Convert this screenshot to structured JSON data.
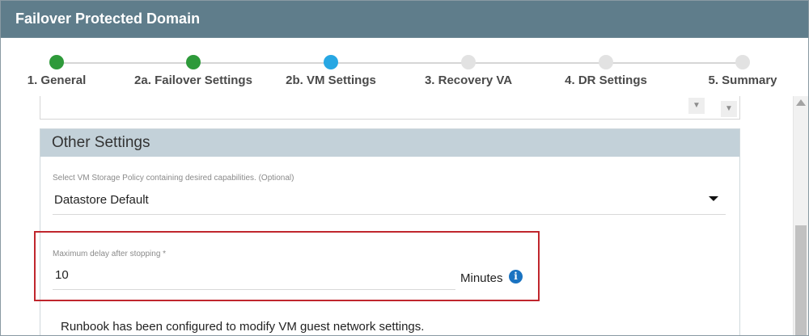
{
  "window": {
    "title": "Failover Protected Domain"
  },
  "stepper": {
    "steps": [
      {
        "label": "1. General",
        "state": "complete",
        "color": "#2e9a3a"
      },
      {
        "label": "2a. Failover Settings",
        "state": "complete",
        "color": "#2e9a3a"
      },
      {
        "label": "2b. VM Settings",
        "state": "active",
        "color": "#27a7e3"
      },
      {
        "label": "3. Recovery VA",
        "state": "pending",
        "color": "#e2e2e2"
      },
      {
        "label": "4. DR Settings",
        "state": "pending",
        "color": "#e2e2e2"
      },
      {
        "label": "5. Summary",
        "state": "pending",
        "color": "#e2e2e2"
      }
    ]
  },
  "other_settings": {
    "title": "Other Settings",
    "storage_policy": {
      "caption": "Select VM Storage Policy containing desired capabilities. (Optional)",
      "value": "Datastore Default"
    },
    "max_delay": {
      "caption": "Maximum delay after stopping *",
      "value": "10",
      "unit": "Minutes"
    },
    "note": "Runbook has been configured to modify VM guest network settings."
  },
  "icons": {
    "info": "info-icon",
    "dropdown": "caret-down-icon"
  },
  "colors": {
    "titlebar": "#5f7d8b",
    "panel_header": "#c3d1d9",
    "highlight": "#c0262d"
  }
}
